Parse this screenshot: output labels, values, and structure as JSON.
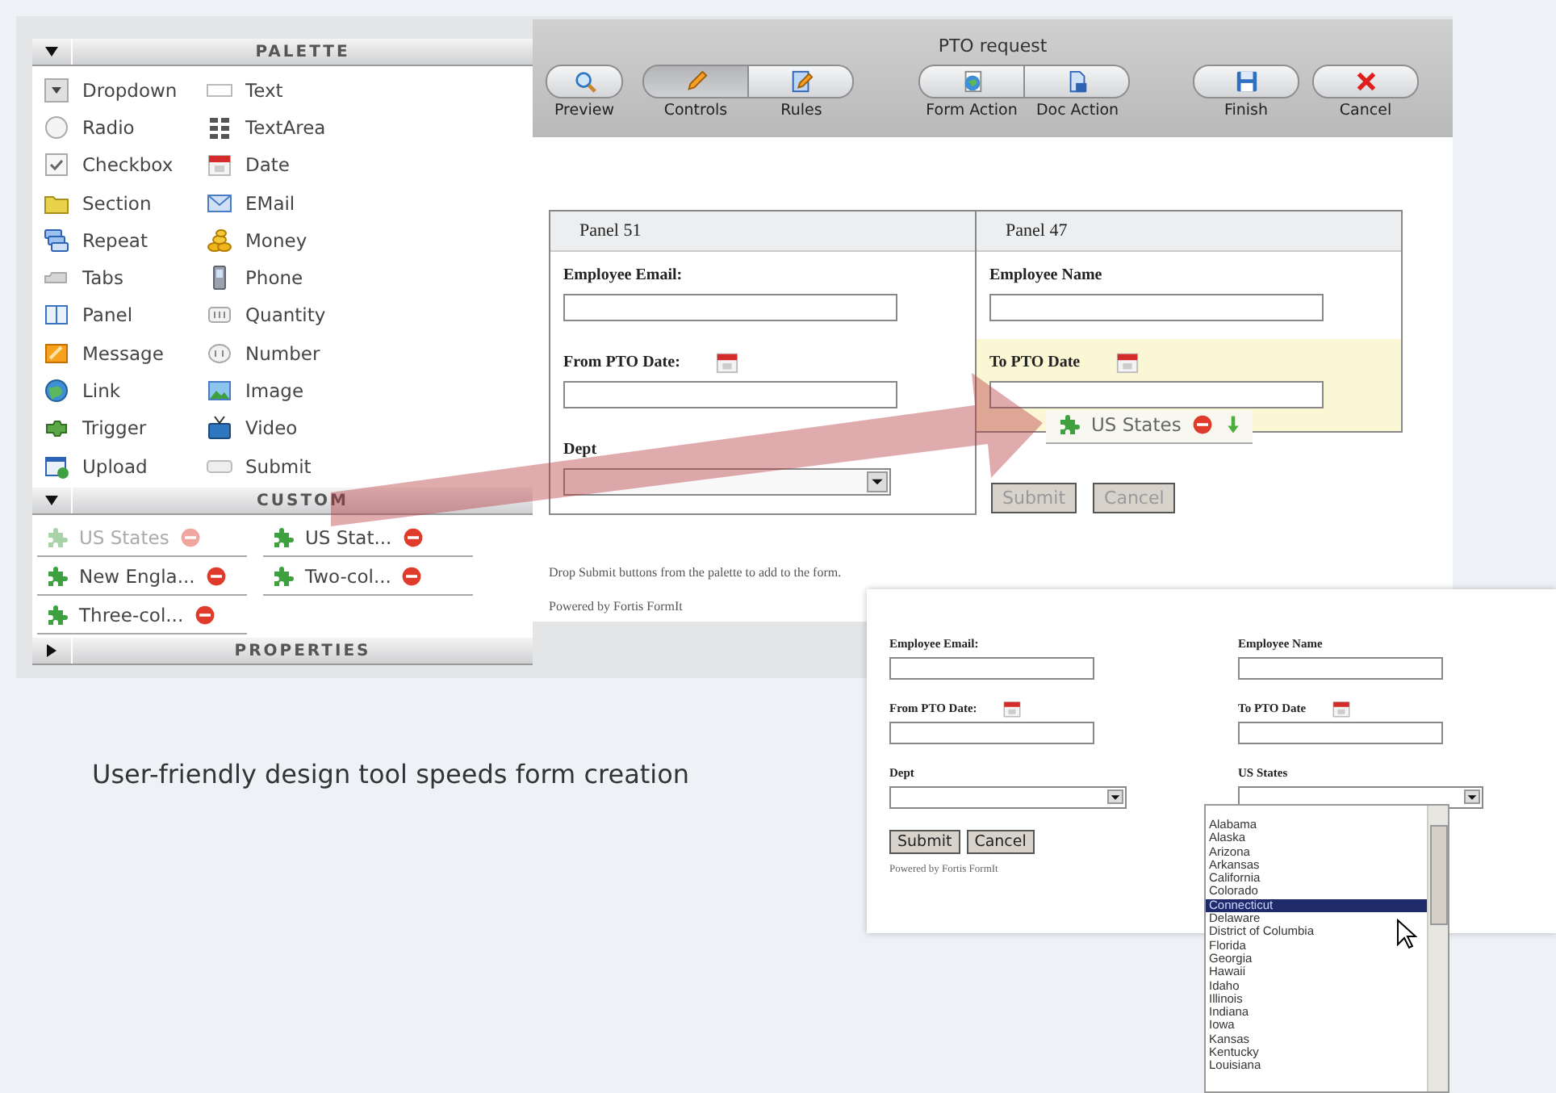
{
  "palette_section": {
    "title": "PALETTE",
    "expanded": true,
    "items": [
      {
        "label": "Dropdown",
        "kind": "dropdown"
      },
      {
        "label": "Text",
        "kind": "text"
      },
      {
        "label": "Radio",
        "kind": "radio"
      },
      {
        "label": "TextArea",
        "kind": "textarea"
      },
      {
        "label": "Checkbox",
        "kind": "checkbox"
      },
      {
        "label": "Date",
        "kind": "date"
      },
      {
        "label": "Section",
        "kind": "section"
      },
      {
        "label": "EMail",
        "kind": "email"
      },
      {
        "label": "Repeat",
        "kind": "repeat"
      },
      {
        "label": "Money",
        "kind": "money"
      },
      {
        "label": "Tabs",
        "kind": "tabs"
      },
      {
        "label": "Phone",
        "kind": "phone"
      },
      {
        "label": "Panel",
        "kind": "panel"
      },
      {
        "label": "Quantity",
        "kind": "quantity"
      },
      {
        "label": "Message",
        "kind": "message"
      },
      {
        "label": "Number",
        "kind": "number"
      },
      {
        "label": "Link",
        "kind": "link"
      },
      {
        "label": "Image",
        "kind": "image"
      },
      {
        "label": "Trigger",
        "kind": "trigger"
      },
      {
        "label": "Video",
        "kind": "video"
      },
      {
        "label": "Upload",
        "kind": "upload"
      },
      {
        "label": "Submit",
        "kind": "submit"
      }
    ]
  },
  "custom_section": {
    "title": "CUSTOM",
    "expanded": true,
    "items": [
      {
        "label": "US States",
        "disabled": true
      },
      {
        "label": "US Stat...",
        "disabled": false
      },
      {
        "label": "New Engla...",
        "disabled": false
      },
      {
        "label": "Two-col...",
        "disabled": false
      },
      {
        "label": "Three-col...",
        "disabled": false
      }
    ]
  },
  "properties_section": {
    "title": "PROPERTIES",
    "expanded": false
  },
  "editor": {
    "title": "PTO request",
    "toolbar": [
      {
        "segmented": false,
        "buttons": [
          {
            "label": "Preview",
            "kind": "preview",
            "selected": false
          }
        ]
      },
      {
        "segmented": true,
        "buttons": [
          {
            "label": "Controls",
            "kind": "controls",
            "selected": true
          },
          {
            "label": "Rules",
            "kind": "rules",
            "selected": false
          }
        ]
      },
      {
        "segmented": true,
        "buttons": [
          {
            "label": "Form Action",
            "kind": "formaction",
            "selected": false
          },
          {
            "label": "Doc Action",
            "kind": "docaction",
            "selected": false
          }
        ]
      },
      {
        "segmented": false,
        "buttons": [
          {
            "label": "Finish",
            "kind": "finish",
            "selected": false
          },
          {
            "label": "Cancel",
            "kind": "cancel",
            "selected": false
          }
        ]
      }
    ],
    "panels": [
      {
        "title": "Panel 51",
        "fields": [
          {
            "label": "Employee Email:",
            "kind": "text",
            "highlighted": false
          },
          {
            "label": "From PTO Date:",
            "kind": "date",
            "highlighted": false
          },
          {
            "label": "Dept",
            "kind": "select",
            "highlighted": false
          }
        ]
      },
      {
        "title": "Panel 47",
        "fields": [
          {
            "label": "Employee Name",
            "kind": "text",
            "highlighted": false
          },
          {
            "label": "To PTO Date",
            "kind": "date",
            "highlighted": true
          }
        ]
      }
    ],
    "form_buttons": [
      {
        "label": "Submit",
        "disabled": true
      },
      {
        "label": "Cancel",
        "disabled": true
      }
    ],
    "hint": "Drop Submit buttons from the palette to add to the form.",
    "footer": "Powered by Fortis FormIt",
    "dragged_control": {
      "label": "US States"
    }
  },
  "caption": "User-friendly design tool speeds form creation",
  "preview": {
    "columns": [
      [
        {
          "label": "Employee Email:",
          "kind": "text"
        },
        {
          "label": "From PTO Date:",
          "kind": "date"
        },
        {
          "label": "Dept",
          "kind": "select"
        }
      ],
      [
        {
          "label": "Employee Name",
          "kind": "text"
        },
        {
          "label": "To PTO Date",
          "kind": "date"
        },
        {
          "label": "US States",
          "kind": "select"
        }
      ]
    ],
    "buttons": [
      {
        "label": "Submit",
        "disabled": false
      },
      {
        "label": "Cancel",
        "disabled": false
      }
    ],
    "footer": "Powered by Fortis FormIt",
    "options": [
      {
        "label": "Alabama",
        "selected": false
      },
      {
        "label": "Alaska",
        "selected": false
      },
      {
        "label": "Arizona",
        "selected": false
      },
      {
        "label": "Arkansas",
        "selected": false
      },
      {
        "label": "California",
        "selected": false
      },
      {
        "label": "Colorado",
        "selected": false
      },
      {
        "label": "Connecticut",
        "selected": true
      },
      {
        "label": "Delaware",
        "selected": false
      },
      {
        "label": "District of Columbia",
        "selected": false
      },
      {
        "label": "Florida",
        "selected": false
      },
      {
        "label": "Georgia",
        "selected": false
      },
      {
        "label": "Hawaii",
        "selected": false
      },
      {
        "label": "Idaho",
        "selected": false
      },
      {
        "label": "Illinois",
        "selected": false
      },
      {
        "label": "Indiana",
        "selected": false
      },
      {
        "label": "Iowa",
        "selected": false
      },
      {
        "label": "Kansas",
        "selected": false
      },
      {
        "label": "Kentucky",
        "selected": false
      },
      {
        "label": "Louisiana",
        "selected": false
      }
    ]
  }
}
